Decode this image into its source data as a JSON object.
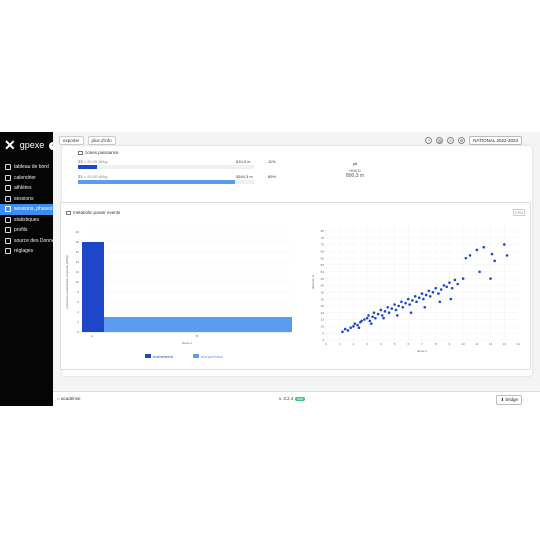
{
  "app": {
    "brand": "gpexe"
  },
  "sidebar": {
    "items": [
      {
        "label": "tableau de bord",
        "active": false
      },
      {
        "label": "calendrier",
        "active": false
      },
      {
        "label": "athlètes",
        "active": false
      },
      {
        "label": "sessions",
        "active": false
      },
      {
        "label": "sessions, phases",
        "active": true
      },
      {
        "label": "statistiques",
        "active": false
      },
      {
        "label": "profils",
        "active": false
      },
      {
        "label": "source des Données",
        "active": false
      },
      {
        "label": "réglages",
        "active": false
      }
    ]
  },
  "toolbar": {
    "export_label": "exporter",
    "more_info_label": "plus d'info",
    "season_label": "NATIONAL 2022-2023"
  },
  "power_zones": {
    "title": "zones puissance",
    "rows": [
      {
        "zone": "Z2",
        "range": "< 20,00 W/kg",
        "value": "610,0",
        "unit": "m",
        "percent": "11%",
        "fraction": 0.11,
        "color": "#1d46c9"
      },
      {
        "zone": "Z1",
        "range": "> 20,00 W/kg",
        "value": "5544,3",
        "unit": "m",
        "percent": "89%",
        "fraction": 0.89,
        "color": "#5b9bf0"
      }
    ],
    "hmld_label": "HMLD",
    "hmld_value": "800,3 m"
  },
  "metabolic": {
    "title": "metabolic power events",
    "legend_a": "événement",
    "legend_b": "récupération",
    "bar_ylabel": "puissance métabolique moyenne (W/kg)",
    "bar_xlabel": "durée s",
    "scatter_ylabel": "distance m",
    "scatter_xlabel": "durée s"
  },
  "footer": {
    "left": "académie",
    "version": "v. 3.2.4",
    "badge": "new",
    "right": "bridge"
  },
  "chart_data": [
    {
      "type": "bar",
      "categories": [
        "A",
        "B"
      ],
      "series": [
        {
          "name": "événement",
          "values": [
            18,
            0
          ],
          "color": "#1d46c9"
        },
        {
          "name": "récupération",
          "values": [
            0,
            3
          ],
          "color": "#5b9bf0"
        }
      ],
      "ylim": [
        0,
        20
      ],
      "yticks": [
        0,
        2,
        4,
        6,
        8,
        10,
        12,
        14,
        16,
        18,
        20
      ]
    },
    {
      "type": "scatter",
      "xlim": [
        0,
        14
      ],
      "ylim": [
        0,
        85
      ],
      "xticks": [
        0,
        1,
        2,
        3,
        4,
        5,
        6,
        7,
        8,
        9,
        10,
        11,
        12,
        13,
        14
      ],
      "yticks": [
        0,
        5,
        10,
        15,
        20,
        25,
        30,
        35,
        40,
        45,
        50,
        55,
        60,
        65,
        70,
        75,
        80
      ],
      "points": [
        [
          1.2,
          6
        ],
        [
          1.4,
          8
        ],
        [
          1.6,
          7
        ],
        [
          1.8,
          9
        ],
        [
          2.0,
          10
        ],
        [
          2.1,
          12
        ],
        [
          2.3,
          11
        ],
        [
          2.5,
          13
        ],
        [
          2.6,
          14
        ],
        [
          2.8,
          15
        ],
        [
          3.0,
          16
        ],
        [
          3.1,
          18
        ],
        [
          3.2,
          14
        ],
        [
          3.4,
          17
        ],
        [
          3.5,
          20
        ],
        [
          3.6,
          16
        ],
        [
          3.8,
          19
        ],
        [
          4.0,
          22
        ],
        [
          4.1,
          18
        ],
        [
          4.3,
          21
        ],
        [
          4.5,
          24
        ],
        [
          4.6,
          20
        ],
        [
          4.8,
          23
        ],
        [
          5.0,
          26
        ],
        [
          5.1,
          22
        ],
        [
          5.3,
          25
        ],
        [
          5.5,
          28
        ],
        [
          5.6,
          24
        ],
        [
          5.8,
          27
        ],
        [
          6.0,
          30
        ],
        [
          6.1,
          26
        ],
        [
          6.3,
          29
        ],
        [
          6.5,
          32
        ],
        [
          6.6,
          28
        ],
        [
          6.8,
          31
        ],
        [
          7.0,
          34
        ],
        [
          7.1,
          30
        ],
        [
          7.3,
          33
        ],
        [
          7.5,
          36
        ],
        [
          7.6,
          32
        ],
        [
          7.8,
          35
        ],
        [
          8.0,
          38
        ],
        [
          8.2,
          34
        ],
        [
          8.4,
          37
        ],
        [
          8.6,
          40
        ],
        [
          8.8,
          39
        ],
        [
          9.0,
          42
        ],
        [
          9.2,
          38
        ],
        [
          9.4,
          44
        ],
        [
          9.6,
          41
        ],
        [
          10.0,
          45
        ],
        [
          10.2,
          60
        ],
        [
          10.5,
          62
        ],
        [
          11.0,
          66
        ],
        [
          11.2,
          50
        ],
        [
          11.5,
          68
        ],
        [
          12.0,
          45
        ],
        [
          12.1,
          63
        ],
        [
          12.3,
          58
        ],
        [
          13.0,
          70
        ],
        [
          13.2,
          62
        ],
        [
          6.2,
          20
        ],
        [
          5.2,
          18
        ],
        [
          4.2,
          16
        ],
        [
          7.2,
          24
        ],
        [
          3.3,
          12
        ],
        [
          8.3,
          28
        ],
        [
          9.1,
          30
        ],
        [
          2.4,
          9
        ]
      ],
      "color": "#1d46c9"
    }
  ]
}
